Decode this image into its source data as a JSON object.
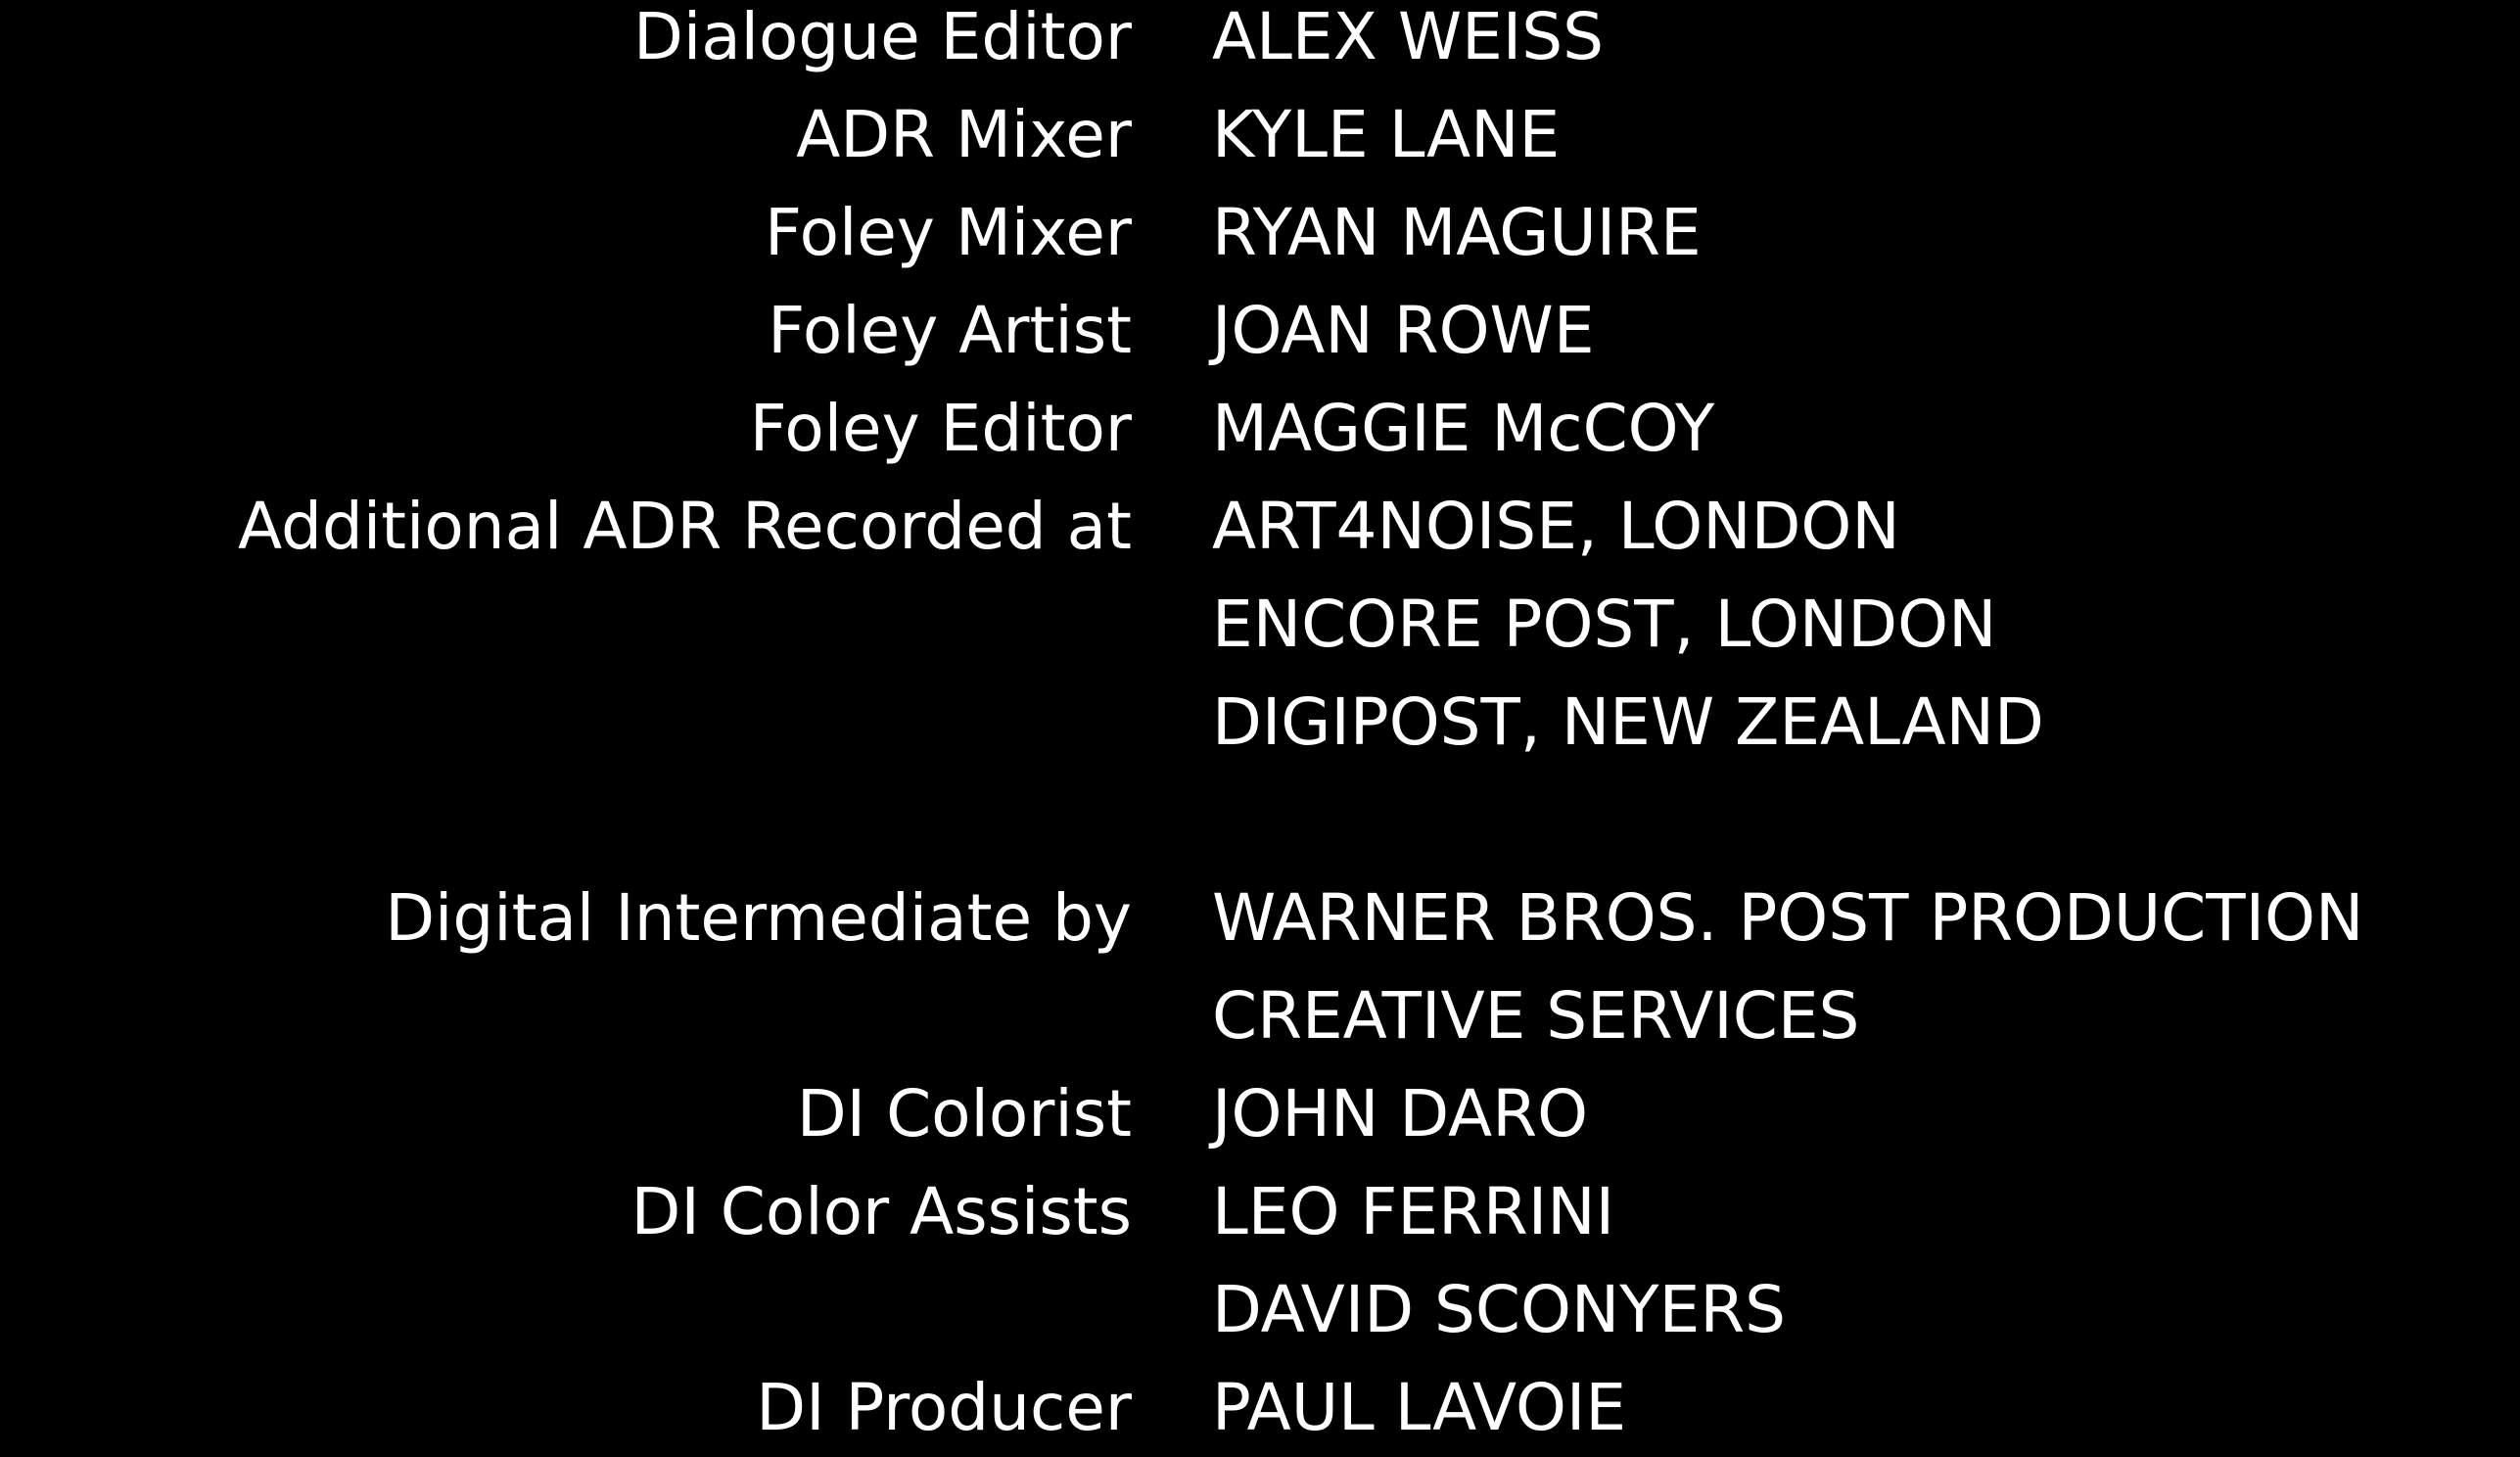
{
  "background_color": "#000000",
  "text_color": "#ffffff",
  "credits": [
    {
      "role": "Dialogue Editor",
      "name": "ALEX WEISS"
    },
    {
      "role": "ADR Mixer",
      "name": "KYLE LANE"
    },
    {
      "role": "Foley Mixer",
      "name": "RYAN MAGUIRE"
    },
    {
      "role": "Foley Artist",
      "name": "JOAN ROWE"
    },
    {
      "role": "Foley Editor",
      "name": "MAGGIE McCOY"
    },
    {
      "role": "Additional ADR Recorded at",
      "name": "ART4NOISE, LONDON"
    },
    {
      "role": "",
      "name": "ENCORE POST, LONDON"
    },
    {
      "role": "",
      "name": "DIGIPOST, NEW ZEALAND"
    },
    {
      "role": "Digital Intermediate by",
      "name": "WARNER BROS. POST PRODUCTION"
    },
    {
      "role": "",
      "name": "CREATIVE SERVICES"
    },
    {
      "role": "DI Colorist",
      "name": "JOHN DARO"
    },
    {
      "role": "DI Color Assists",
      "name": "LEO FERRINI"
    },
    {
      "role": "",
      "name": "DAVID SCONYERS"
    },
    {
      "role": "DI Producer",
      "name": "PAUL LAVOIE"
    }
  ]
}
